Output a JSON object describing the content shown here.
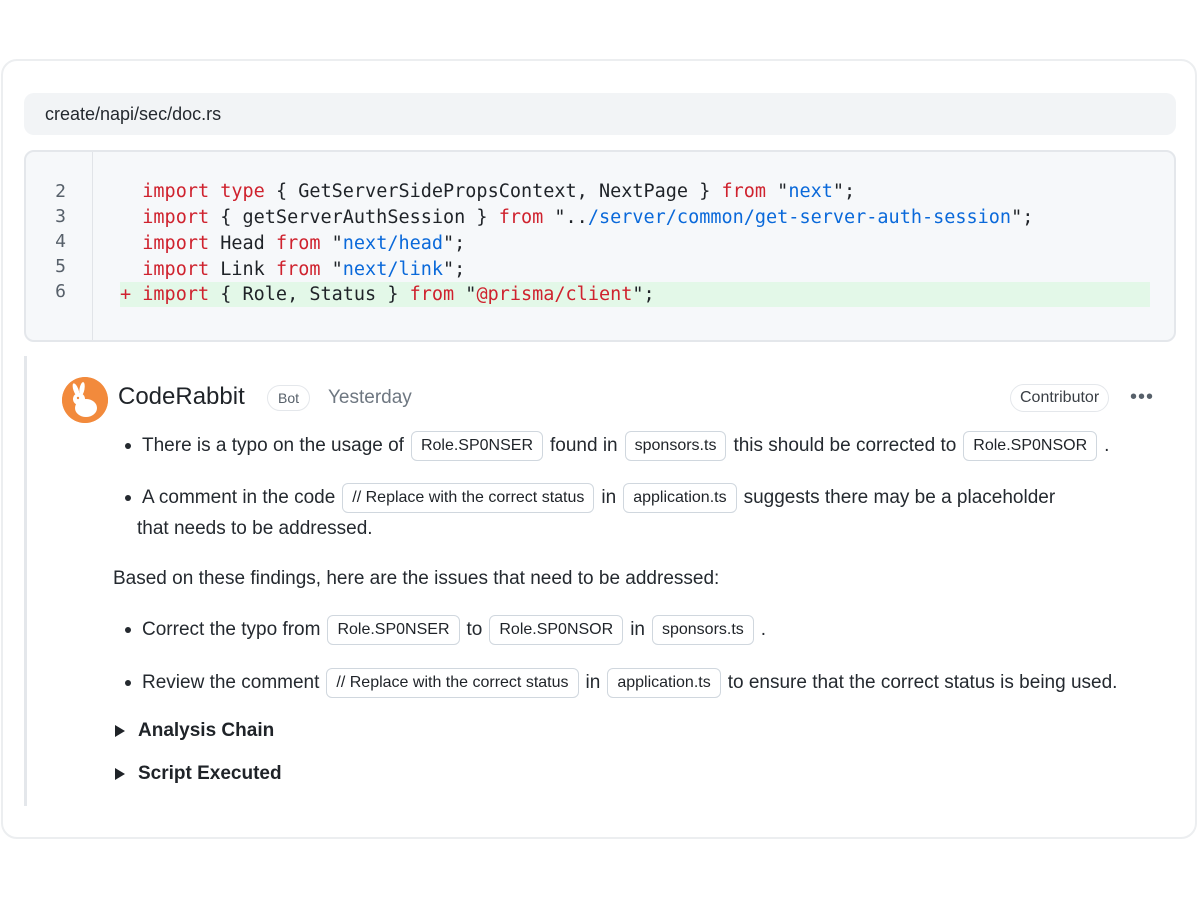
{
  "file": {
    "path": "create/napi/sec/doc.rs"
  },
  "code": {
    "line_numbers": [
      "2",
      "3",
      "4",
      "5",
      "6"
    ],
    "line2": {
      "kw1": "import",
      "kw2": "type",
      "mid": " { GetServerSidePropsContext, NextPage } ",
      "kw3": "from",
      "q1": " \"",
      "str": "next",
      "q2": "\";"
    },
    "line3": {
      "kw1": "import",
      "mid": " { getServerAuthSession } ",
      "kw2": "from",
      "q1": " \"..",
      "str": "/server/common/get-server-auth-session",
      "q2": "\";"
    },
    "line4": {
      "kw1": "import",
      "mid": " Head ",
      "kw2": "from",
      "q1": " \"",
      "str": "next/head",
      "q2": "\";"
    },
    "line5": {
      "kw1": "import",
      "mid": " Link ",
      "kw2": "from",
      "q1": " \"",
      "str": "next/link",
      "q2": "\";"
    },
    "line6": {
      "plus": "+ ",
      "kw1": "import",
      "mid": " { Role, Status } ",
      "kw2": "from",
      "q1": " \"",
      "str": "@prisma/client",
      "q2": "\";"
    }
  },
  "comment": {
    "author": "CodeRabbit",
    "bot_badge": "Bot",
    "time": "Yesterday",
    "role_badge": "Contributor",
    "more_icon": "•••",
    "bullet1": {
      "t1": "There is a typo on the usage of",
      "c1": "Role.SP0NSER",
      "t2": "found in",
      "c2": "sponsors.ts",
      "t3": "this should be corrected to",
      "c3": "Role.SP0NSOR",
      "t4": "."
    },
    "bullet2": {
      "t1": "A comment in the code",
      "c1": "// Replace with the correct status",
      "t2": "in",
      "c2": "application.ts",
      "t3": "suggests there may be a placeholder",
      "t4": "that needs to be addressed."
    },
    "findings": "Based on these findings, here are the issues that need to be addressed:",
    "bullet3": {
      "t1": "Correct the typo from",
      "c1": "Role.SP0NSER",
      "t2": "to",
      "c2": "Role.SP0NSOR",
      "t3": "in",
      "c3": "sponsors.ts",
      "t4": "."
    },
    "bullet4": {
      "t1": "Review the comment",
      "c1": "// Replace with the correct status",
      "t2": "in",
      "c2": "application.ts",
      "t3": "to ensure that the correct status is being used."
    },
    "analysis_chain": "Analysis Chain",
    "script_executed": "Script Executed"
  },
  "colors": {
    "keyword": "#cf222e",
    "string": "#0a69da",
    "added_bg": "#e3f8e8",
    "avatar": "#f28a3c"
  }
}
